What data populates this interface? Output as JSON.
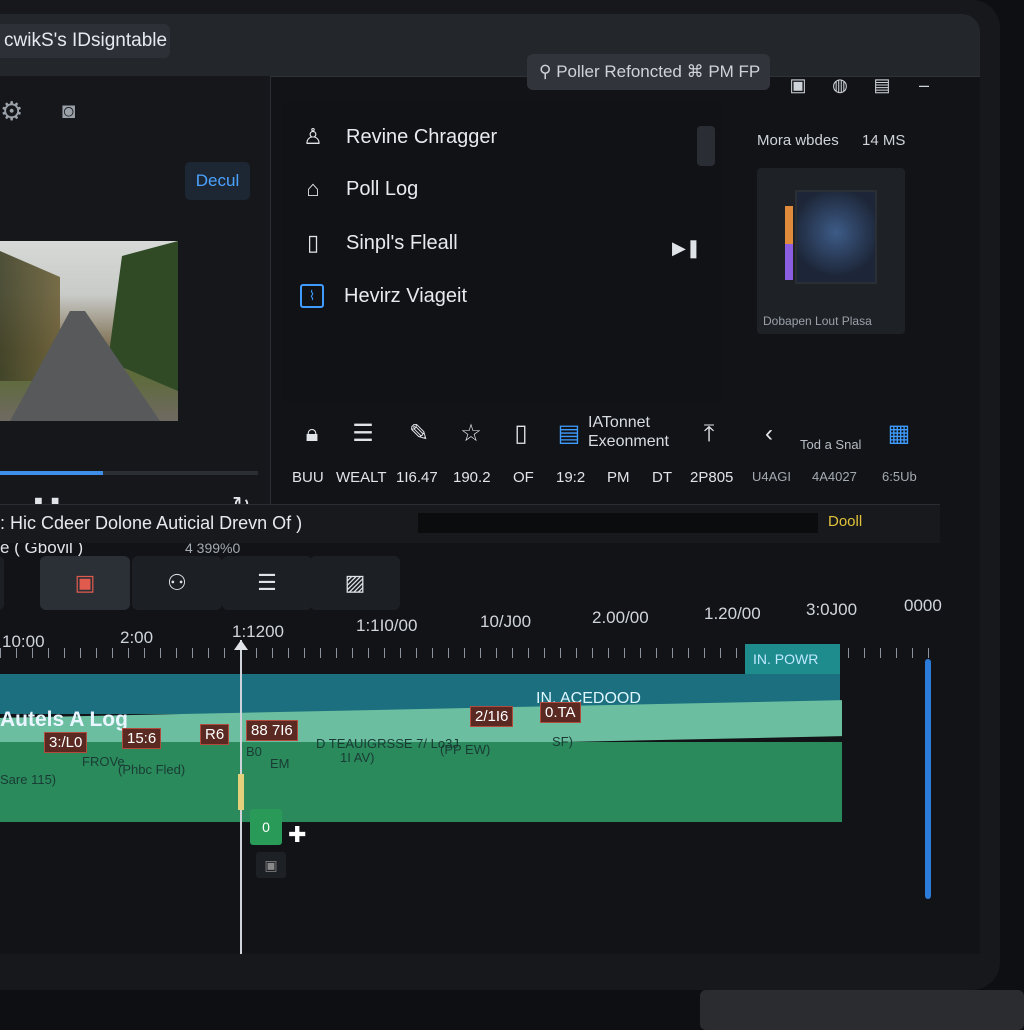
{
  "app": {
    "title": "cwikS's IDsigntable"
  },
  "user": {
    "label": "Poller Refoncted ⌘ PM FP"
  },
  "preview": {
    "deploy_button": "Decul",
    "label": "e ( Gbovil )",
    "time": "4 399%0",
    "progress_percent": 40
  },
  "menu": {
    "items": [
      {
        "icon": "user-icon",
        "label": "Revine Chragger"
      },
      {
        "icon": "home-icon",
        "label": "Poll Log"
      },
      {
        "icon": "phone-icon",
        "label": "Sinpl's Fleall"
      },
      {
        "icon": "chart-icon",
        "label": "Hevirz Viageit"
      }
    ]
  },
  "right_panel": {
    "heading": "Mora wbdes",
    "time": "14 MS",
    "thumb_caption": "Dobapen Lout Plasa"
  },
  "toolbar": {
    "text_line1": "IATonnet",
    "text_line2": "Exeonment",
    "small_text": "Tod a Snal"
  },
  "stats": [
    "BUU",
    "WEALT",
    "1I6.47",
    "190.2",
    "OF",
    "19:2",
    "PM",
    "DT",
    "2P805",
    "U4AGI",
    "4A4027",
    "6:5Ub"
  ],
  "info": {
    "text": ": Hic Cdeer Dolone Auticial Drevn Of )",
    "accent": "Dooll"
  },
  "ruler": {
    "labels": [
      "10:00",
      "2:00",
      "1:1200",
      "1:1I0/00",
      "10/J00",
      "2.00/00",
      "1.20/00",
      "3:0J00",
      "0000"
    ]
  },
  "timeline": {
    "clip_title": "Autels A Log",
    "tag": "IN. POWR",
    "label": "IN. ACEDOOD",
    "codes": [
      "3:/L0",
      "15:6",
      "R6",
      "88 7I6",
      "2/1I6",
      "0.TA"
    ],
    "notes": [
      "FROVe",
      "(Phbc Fled)",
      "Sare 115)",
      "B0",
      "EM",
      "D TEAUIGRSSE 7/ Lo3J",
      "1I AV)",
      "(PP EW)",
      "SF)"
    ],
    "chip": "0"
  }
}
